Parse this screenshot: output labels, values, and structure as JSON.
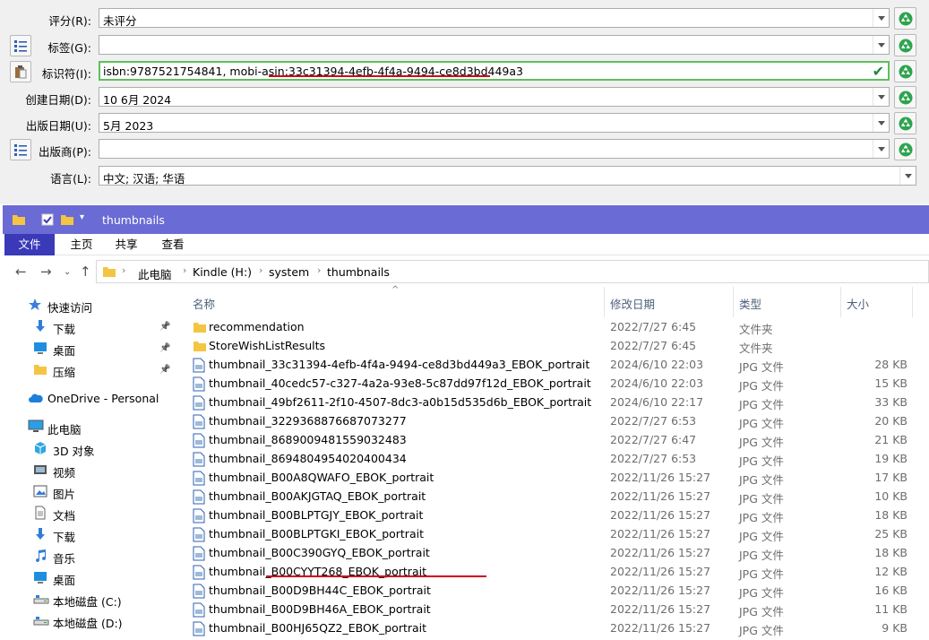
{
  "metadata": {
    "rows": [
      {
        "key": "rating",
        "label": "评分(R):",
        "value": "未评分",
        "side_icon": "",
        "control": "dropdown"
      },
      {
        "key": "tags",
        "label": "标签(G):",
        "value": "",
        "side_icon": "list-icon",
        "control": "dropdown"
      },
      {
        "key": "ids",
        "label": "标识符(I):",
        "value": "isbn:9787521754841, mobi-asin:33c31394-4efb-4f4a-9494-ce8d3bd449a3",
        "side_icon": "clipboard-icon",
        "control": "valid"
      },
      {
        "key": "created",
        "label": "创建日期(D):",
        "value": "10 6月 2024",
        "side_icon": "",
        "control": "dropdown"
      },
      {
        "key": "published",
        "label": "出版日期(U):",
        "value": "5月 2023",
        "side_icon": "",
        "control": "dropdown"
      },
      {
        "key": "publisher",
        "label": "出版商(P):",
        "value": "",
        "side_icon": "list-icon",
        "control": "dropdown"
      },
      {
        "key": "language",
        "label": "语言(L):",
        "value": "中文; 汉语; 华语",
        "side_icon": "",
        "control": "dropdown-wide"
      }
    ],
    "accent_valid": "#5cc05c",
    "highlight_color": "#d0021b"
  },
  "explorer": {
    "title": "thumbnails",
    "titlebar_color": "#6b6bd5",
    "ribbon_tabs": [
      "文件",
      "主页",
      "共享",
      "查看"
    ],
    "breadcrumb": [
      "此电脑",
      "Kindle (H:)",
      "system",
      "thumbnails"
    ],
    "nav": [
      {
        "label": "快速访问",
        "icon": "star-icon",
        "indent": 0,
        "pinned": false
      },
      {
        "label": "下载",
        "icon": "download-icon",
        "indent": 1,
        "pinned": true
      },
      {
        "label": "桌面",
        "icon": "desktop-icon",
        "indent": 1,
        "pinned": true
      },
      {
        "label": "压缩",
        "icon": "folder-icon",
        "indent": 1,
        "pinned": true
      },
      {
        "label": "OneDrive - Personal",
        "icon": "cloud-icon",
        "indent": 0,
        "pinned": false
      },
      {
        "label": "此电脑",
        "icon": "computer-icon",
        "indent": 0,
        "pinned": false
      },
      {
        "label": "3D 对象",
        "icon": "cube-icon",
        "indent": 1,
        "pinned": false
      },
      {
        "label": "视频",
        "icon": "video-icon",
        "indent": 1,
        "pinned": false
      },
      {
        "label": "图片",
        "icon": "picture-icon",
        "indent": 1,
        "pinned": false
      },
      {
        "label": "文档",
        "icon": "document-icon",
        "indent": 1,
        "pinned": false
      },
      {
        "label": "下载",
        "icon": "download-icon",
        "indent": 1,
        "pinned": false
      },
      {
        "label": "音乐",
        "icon": "music-icon",
        "indent": 1,
        "pinned": false
      },
      {
        "label": "桌面",
        "icon": "desktop-icon",
        "indent": 1,
        "pinned": false
      },
      {
        "label": "本地磁盘 (C:)",
        "icon": "drive-icon",
        "indent": 1,
        "pinned": false
      },
      {
        "label": "本地磁盘 (D:)",
        "icon": "drive-icon",
        "indent": 1,
        "pinned": false
      }
    ],
    "columns": [
      "名称",
      "修改日期",
      "类型",
      "大小"
    ],
    "files": [
      {
        "name": "recommendation",
        "date": "2022/7/27 6:45",
        "type": "文件夹",
        "size": "",
        "kind": "folder"
      },
      {
        "name": "StoreWishListResults",
        "date": "2022/7/27 6:45",
        "type": "文件夹",
        "size": "",
        "kind": "folder"
      },
      {
        "name": "thumbnail_33c31394-4efb-4f4a-9494-ce8d3bd449a3_EBOK_portrait",
        "date": "2024/6/10 22:03",
        "type": "JPG 文件",
        "size": "28 KB",
        "kind": "file"
      },
      {
        "name": "thumbnail_40cedc57-c327-4a2a-93e8-5c87dd97f12d_EBOK_portrait",
        "date": "2024/6/10 22:03",
        "type": "JPG 文件",
        "size": "15 KB",
        "kind": "file"
      },
      {
        "name": "thumbnail_49bf2611-2f10-4507-8dc3-a0b15d535d6b_EBOK_portrait",
        "date": "2024/6/10 22:17",
        "type": "JPG 文件",
        "size": "33 KB",
        "kind": "file"
      },
      {
        "name": "thumbnail_3229368876687073277",
        "date": "2022/7/27 6:53",
        "type": "JPG 文件",
        "size": "20 KB",
        "kind": "file"
      },
      {
        "name": "thumbnail_8689009481559032483",
        "date": "2022/7/27 6:47",
        "type": "JPG 文件",
        "size": "21 KB",
        "kind": "file"
      },
      {
        "name": "thumbnail_8694804954020400434",
        "date": "2022/7/27 6:53",
        "type": "JPG 文件",
        "size": "19 KB",
        "kind": "file"
      },
      {
        "name": "thumbnail_B00A8QWAFO_EBOK_portrait",
        "date": "2022/11/26 15:27",
        "type": "JPG 文件",
        "size": "17 KB",
        "kind": "file"
      },
      {
        "name": "thumbnail_B00AKJGTAQ_EBOK_portrait",
        "date": "2022/11/26 15:27",
        "type": "JPG 文件",
        "size": "10 KB",
        "kind": "file"
      },
      {
        "name": "thumbnail_B00BLPTGJY_EBOK_portrait",
        "date": "2022/11/26 15:27",
        "type": "JPG 文件",
        "size": "18 KB",
        "kind": "file"
      },
      {
        "name": "thumbnail_B00BLPTGKI_EBOK_portrait",
        "date": "2022/11/26 15:27",
        "type": "JPG 文件",
        "size": "25 KB",
        "kind": "file"
      },
      {
        "name": "thumbnail_B00C390GYQ_EBOK_portrait",
        "date": "2022/11/26 15:27",
        "type": "JPG 文件",
        "size": "18 KB",
        "kind": "file"
      },
      {
        "name": "thumbnail_B00CYYT268_EBOK_portrait",
        "date": "2022/11/26 15:27",
        "type": "JPG 文件",
        "size": "12 KB",
        "kind": "file"
      },
      {
        "name": "thumbnail_B00D9BH44C_EBOK_portrait",
        "date": "2022/11/26 15:27",
        "type": "JPG 文件",
        "size": "16 KB",
        "kind": "file"
      },
      {
        "name": "thumbnail_B00D9BH46A_EBOK_portrait",
        "date": "2022/11/26 15:27",
        "type": "JPG 文件",
        "size": "11 KB",
        "kind": "file"
      },
      {
        "name": "thumbnail_B00HJ65QZ2_EBOK_portrait",
        "date": "2022/11/26 15:27",
        "type": "JPG 文件",
        "size": "9 KB",
        "kind": "file"
      }
    ]
  }
}
